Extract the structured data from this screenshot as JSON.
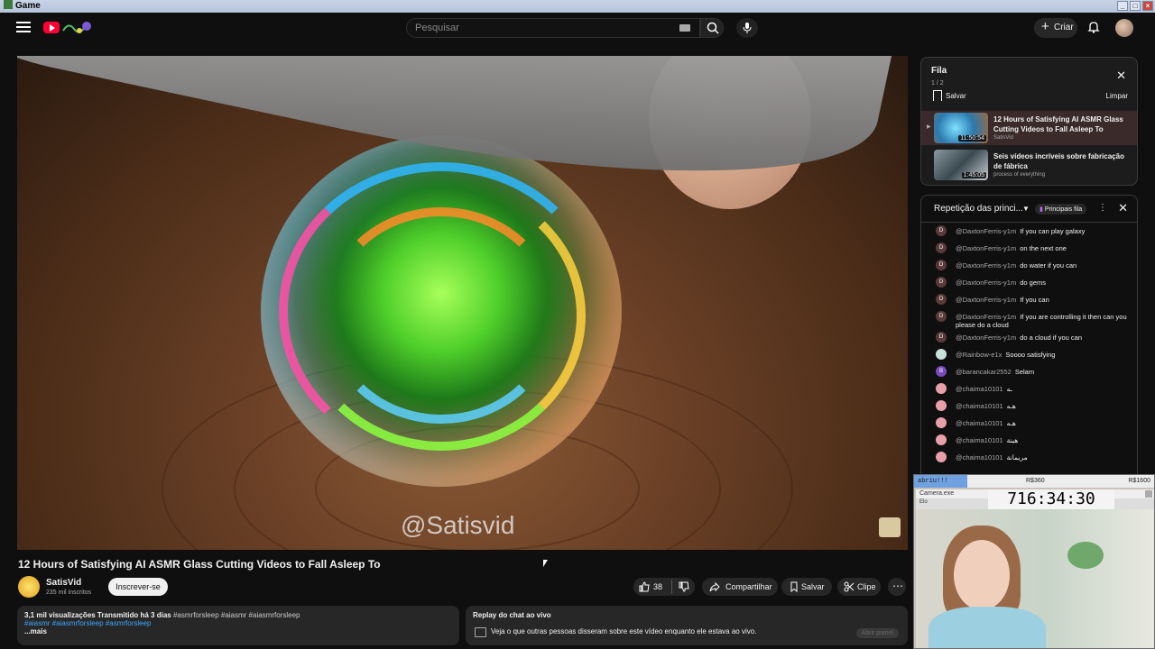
{
  "window": {
    "title": "Game"
  },
  "masthead": {
    "search_placeholder": "Pesquisar",
    "create_label": "Criar"
  },
  "video": {
    "watermark": "@Satisvid",
    "title": "12 Hours of Satisfying AI ASMR Glass Cutting Videos to Fall Asleep To",
    "channel": "SatisVid",
    "subscribers": "235 mil inscritos",
    "subscribe_label": "Inscrever-se",
    "likes": "38",
    "share_label": "Compartilhar",
    "save_label": "Salvar",
    "clip_label": "Clipe"
  },
  "description": {
    "stats": "3,1 mil visualizações  Transmitido há 3 dias",
    "tags_inline": "#asmrforsleep #aiasmr #aiasmrforsleep",
    "tags_line2": "#aiasmr #aiasmrforsleep #asmrforsleep",
    "more": "...mais"
  },
  "replay": {
    "title": "Replay do chat ao vivo",
    "desc": "Veja o que outras pessoas disseram sobre este vídeo enquanto ele estava ao vivo.",
    "open_panel": "Abrir painel"
  },
  "queue": {
    "title": "Fila",
    "count": "1 / 2",
    "save": "Salvar",
    "clear": "Limpar",
    "items": [
      {
        "title": "12 Hours of Satisfying AI ASMR Glass Cutting Videos to Fall Asleep To",
        "channel": "SatisVid",
        "duration": "11:50:54"
      },
      {
        "title": "Seis vídeos incríveis sobre fabricação de fábrica",
        "channel": "process of everything",
        "duration": "1:45:05"
      }
    ]
  },
  "chat": {
    "mode": "Repetição das princi...",
    "badge": "Principais fila",
    "messages": [
      {
        "initial": "D",
        "color": "#5a3a3a",
        "author": "@DaxtonFerris-y1m",
        "text": "If you can play galaxy"
      },
      {
        "initial": "D",
        "color": "#5a3a3a",
        "author": "@DaxtonFerris-y1m",
        "text": "on the next one"
      },
      {
        "initial": "D",
        "color": "#5a3a3a",
        "author": "@DaxtonFerris-y1m",
        "text": "do water if you can"
      },
      {
        "initial": "D",
        "color": "#5a3a3a",
        "author": "@DaxtonFerris-y1m",
        "text": "do gems"
      },
      {
        "initial": "D",
        "color": "#5a3a3a",
        "author": "@DaxtonFerris-y1m",
        "text": "If you can"
      },
      {
        "initial": "D",
        "color": "#5a3a3a",
        "author": "@DaxtonFerris-y1m",
        "text": "If you are controlling it then can you please do a cloud"
      },
      {
        "initial": "D",
        "color": "#5a3a3a",
        "author": "@DaxtonFerris-y1m",
        "text": "do a cloud if you can"
      },
      {
        "initial": "",
        "color": "#c8e0d8",
        "author": "@Rainbow-e1x",
        "text": "Soooo satisfying"
      },
      {
        "initial": "B",
        "color": "#7a4ab8",
        "author": "@barancakar2552",
        "text": "Selam"
      },
      {
        "initial": "",
        "color": "#e8a0a8",
        "author": "@chaima10101",
        "text": "ـه"
      },
      {
        "initial": "",
        "color": "#e8a0a8",
        "author": "@chaima10101",
        "text": "هـه"
      },
      {
        "initial": "",
        "color": "#e8a0a8",
        "author": "@chaima10101",
        "text": "هـه"
      },
      {
        "initial": "",
        "color": "#e8a0a8",
        "author": "@chaima10101",
        "text": "هينة"
      },
      {
        "initial": "",
        "color": "#e8a0a8",
        "author": "@chaima10101",
        "text": "مريمانة"
      }
    ]
  },
  "stream_overlay": {
    "goal_label": "abriu!!!",
    "goal_mid": "R$360",
    "goal_max": "R$1600",
    "goal_progress": 0.22,
    "camera_title": "Camera.exe",
    "camera_sub": "Elo",
    "timer": "716:34:30"
  }
}
